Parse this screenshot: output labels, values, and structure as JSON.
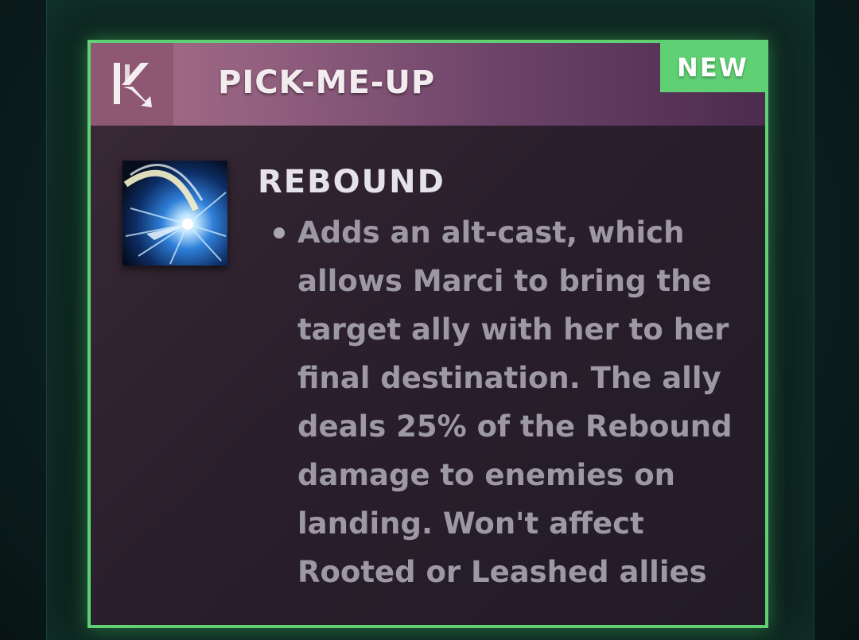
{
  "header": {
    "title": "PICK-ME-UP",
    "badge": "NEW",
    "logo_icon": "marci-k-icon"
  },
  "ability": {
    "icon": "rebound-ability-icon",
    "name": "REBOUND",
    "description_lines": [
      "Adds an alt-cast, which",
      "allows Marci to bring the",
      "target ally with her to her",
      "final destination. The ally",
      "deals 25% of the Rebound",
      "damage to enemies on",
      "landing. Won't affect",
      "Rooted or Leashed allies"
    ]
  },
  "colors": {
    "accent_green": "#5fd174",
    "header_pink": "#a86e8b",
    "header_purple": "#4c2b4f",
    "card_bg": "#2a1f2c",
    "text_light": "#e6e2ea",
    "text_muted": "#9c98a6"
  }
}
